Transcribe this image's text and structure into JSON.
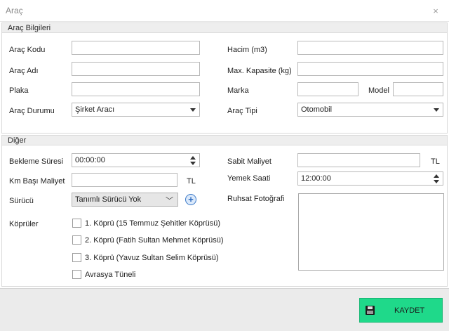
{
  "window": {
    "title": "Araç",
    "close_glyph": "×"
  },
  "vehicle_info": {
    "title": "Araç Bilgileri",
    "code_label": "Araç Kodu",
    "code_value": "",
    "name_label": "Araç Adı",
    "name_value": "",
    "plate_label": "Plaka",
    "plate_value": "",
    "status_label": "Araç Durumu",
    "status_value": "Şirket Aracı",
    "volume_label": "Hacim (m3)",
    "volume_value": "",
    "capacity_label": "Max. Kapasite (kg)",
    "capacity_value": "",
    "brand_label": "Marka",
    "brand_value": "",
    "model_label": "Model",
    "model_value": "",
    "type_label": "Araç Tipi",
    "type_value": "Otomobil"
  },
  "other": {
    "title": "Diğer",
    "wait_label": "Bekleme Süresi",
    "wait_value": "00:00:00",
    "km_cost_label": "Km Başı Maliyet",
    "km_cost_value": "",
    "km_cost_unit": "TL",
    "driver_label": "Sürücü",
    "driver_value": "Tanımlı Sürücü Yok",
    "fixed_cost_label": "Sabit Maliyet",
    "fixed_cost_value": "",
    "fixed_cost_unit": "TL",
    "meal_time_label": "Yemek Saati",
    "meal_time_value": "12:00:00",
    "photo_label": "Ruhsat Fotoğrafi",
    "bridges_label": "Köprüler",
    "bridges": [
      {
        "label": "1. Köprü (15 Temmuz Şehitler Köprüsü)",
        "checked": false
      },
      {
        "label": "2. Köprü (Fatih Sultan Mehmet Köprüsü)",
        "checked": false
      },
      {
        "label": "3. Köprü (Yavuz Sultan Selim Köprüsü)",
        "checked": false
      },
      {
        "label": "Avrasya Tüneli",
        "checked": false
      }
    ]
  },
  "footer": {
    "save_label": "KAYDET"
  },
  "icons": {
    "add_driver": "plus-circle-icon",
    "save": "floppy-disk-icon",
    "close": "close-icon"
  },
  "colors": {
    "save_button": "#1fd98a",
    "group_header": "#eeeeee",
    "footer": "#ebebeb"
  }
}
